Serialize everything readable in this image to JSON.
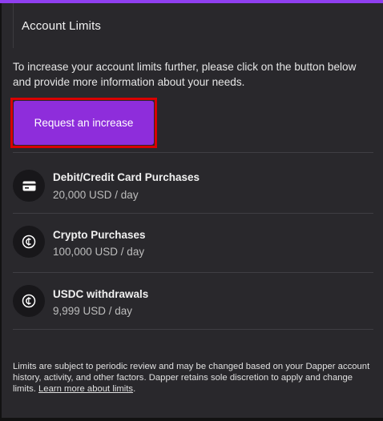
{
  "header": {
    "title": "Account Limits"
  },
  "intro": "To increase your account limits further, please click on the button below and provide more information about your needs.",
  "request_button": {
    "label": "Request an increase"
  },
  "limits": [
    {
      "name": "Debit/Credit Card Purchases",
      "value": "20,000 USD / day",
      "icon": "credit-card-icon"
    },
    {
      "name": "Crypto Purchases",
      "value": "100,000 USD / day",
      "icon": "crypto-coin-icon"
    },
    {
      "name": "USDC withdrawals",
      "value": "9,999 USD / day",
      "icon": "crypto-coin-icon"
    }
  ],
  "footer": {
    "text": "Limits are subject to periodic review and may be changed based on your Dapper account history, activity, and other factors. Dapper retains sole discretion to apply and change limits.",
    "link_label": "Learn more about limits",
    "trailing": "."
  },
  "colors": {
    "accent": "#8e2ddb",
    "highlight": "#d90000",
    "panel": "#29282c",
    "background": "#121212"
  }
}
